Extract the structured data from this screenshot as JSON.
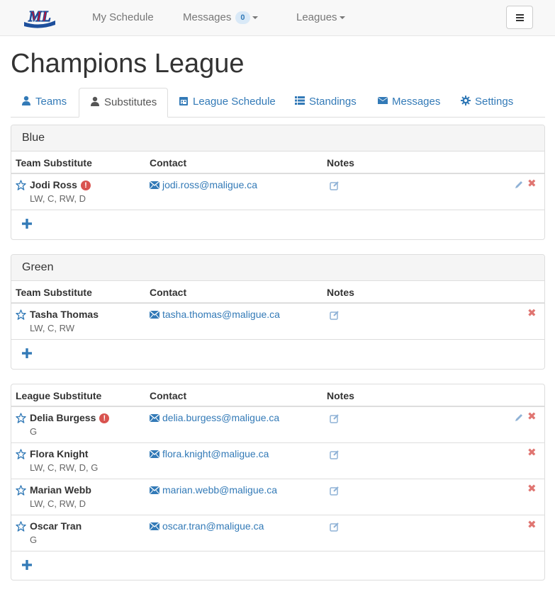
{
  "nav": {
    "logo_text": "ML",
    "my_schedule": "My Schedule",
    "messages": "Messages",
    "messages_count": "0",
    "leagues": "Leagues"
  },
  "page": {
    "title": "Champions League"
  },
  "tabs": [
    {
      "label": "Teams"
    },
    {
      "label": "Substitutes"
    },
    {
      "label": "League Schedule"
    },
    {
      "label": "Standings"
    },
    {
      "label": "Messages"
    },
    {
      "label": "Settings"
    }
  ],
  "columns": {
    "team_substitute": "Team Substitute",
    "league_substitute": "League Substitute",
    "contact": "Contact",
    "notes": "Notes"
  },
  "panels": [
    {
      "title": "Blue",
      "rows": [
        {
          "name": "Jodi Ross",
          "alert": "!",
          "positions": "LW, C, RW, D",
          "email": "jodi.ross@maligue.ca",
          "delete": "✖"
        }
      ]
    },
    {
      "title": "Green",
      "rows": [
        {
          "name": "Tasha Thomas",
          "positions": "LW, C, RW",
          "email": "tasha.thomas@maligue.ca",
          "delete": "✖"
        }
      ]
    },
    {
      "rows": [
        {
          "name": "Delia Burgess",
          "alert": "!",
          "positions": "G",
          "email": "delia.burgess@maligue.ca",
          "delete": "✖"
        },
        {
          "name": "Flora Knight",
          "positions": "LW, C, RW, D, G",
          "email": "flora.knight@maligue.ca",
          "delete": "✖"
        },
        {
          "name": "Marian Webb",
          "positions": "LW, C, RW, D",
          "email": "marian.webb@maligue.ca",
          "delete": "✖"
        },
        {
          "name": "Oscar Tran",
          "positions": "G",
          "email": "oscar.tran@maligue.ca",
          "delete": "✖"
        }
      ]
    }
  ],
  "colors": {
    "link": "#337ab7",
    "danger": "#d9534f",
    "delete": "#e07571",
    "brand_red": "#c8102e",
    "brand_blue": "#1d4f9c"
  },
  "icons": [
    "user-icon",
    "calendar-icon",
    "list-icon",
    "envelope-icon",
    "gear-icon",
    "star-icon",
    "edit-note-icon",
    "pencil-icon",
    "remove-icon",
    "plus-icon"
  ]
}
